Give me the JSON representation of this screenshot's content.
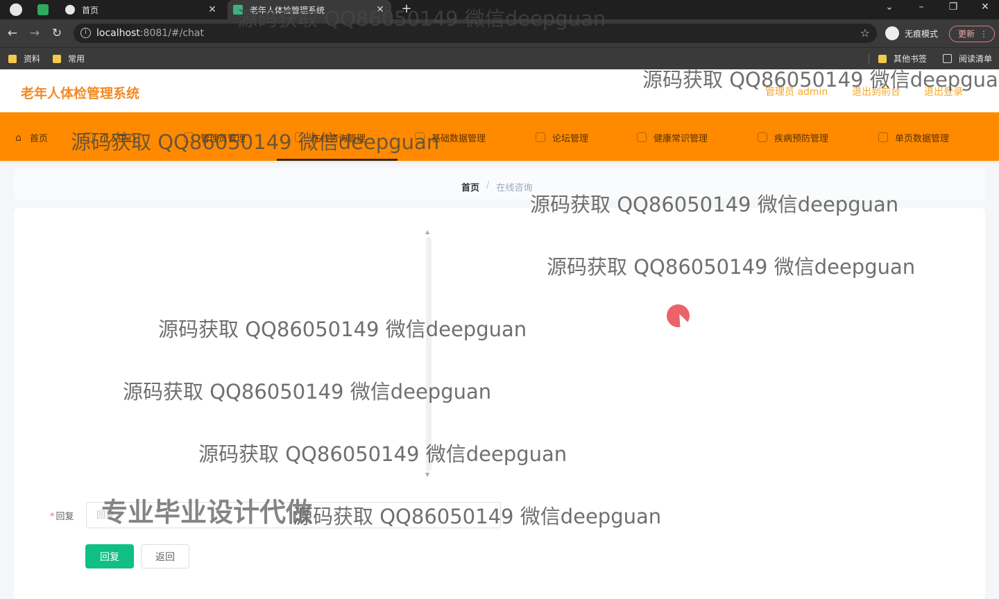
{
  "browser": {
    "tabs": [
      {
        "title": "首页"
      },
      {
        "title": "老年人体检管理系统"
      }
    ],
    "url_host": "localhost",
    "url_rest": ":8081/#/chat",
    "incognito_label": "无痕模式",
    "update_label": "更新",
    "bookmarks": [
      "资料",
      "常用"
    ],
    "other_bookmarks": "其他书签",
    "reading_list": "阅读清单"
  },
  "app": {
    "title": "老年人体检管理系统",
    "user_label": "管理员 admin",
    "back_to_front": "退出到前台",
    "logout": "退出登录"
  },
  "nav": {
    "items": [
      {
        "label": "首页",
        "icon": "home-icon"
      },
      {
        "label": "个人中心",
        "icon": "user-icon"
      },
      {
        "label": "管理员管理",
        "icon": "admin-icon"
      },
      {
        "label": "在线咨询管理",
        "icon": "chat-icon"
      },
      {
        "label": "基础数据管理",
        "icon": "data-icon"
      },
      {
        "label": "论坛管理",
        "icon": "forum-icon"
      },
      {
        "label": "健康常识管理",
        "icon": "health-icon"
      },
      {
        "label": "疾病预防管理",
        "icon": "prevention-icon"
      },
      {
        "label": "单页数据管理",
        "icon": "page-icon"
      }
    ],
    "active_index": 3
  },
  "breadcrumb": {
    "home": "首页",
    "separator": "/",
    "current": "在线咨询"
  },
  "form": {
    "reply_label": "回复",
    "reply_placeholder": "回复",
    "reply_button": "回复",
    "back_button": "返回"
  },
  "watermark": {
    "text": "源码获取 QQ86050149 微信deepguan",
    "banner": "专业毕业设计代做"
  },
  "colors": {
    "accent": "#ff8a00",
    "title": "#f08a24",
    "primary_button": "#0fbf84"
  }
}
